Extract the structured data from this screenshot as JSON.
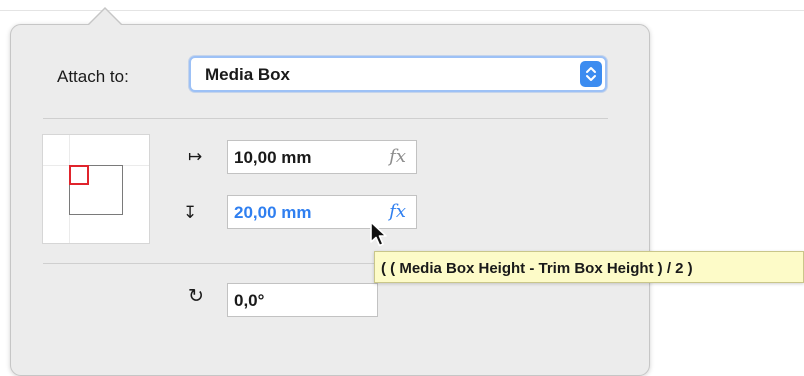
{
  "attach": {
    "label": "Attach to:",
    "selected": "Media Box"
  },
  "position": {
    "x_value": "10,00 mm",
    "y_value": "20,00 mm",
    "fx_label": "fx",
    "horizontal_icon": "↦",
    "vertical_icon": "↧"
  },
  "rotation": {
    "icon": "↻",
    "value": "0,0°"
  },
  "tooltip": {
    "text": "( ( Media Box Height - Trim Box Height ) / 2 )"
  },
  "colors": {
    "accent": "#3c8cf0",
    "active_text": "#2f7ff0",
    "anchor_marker": "#e0242c",
    "tooltip_bg": "#fdfbc8"
  },
  "icons": {
    "select": "up-down-chevron-icon",
    "cursor": "mouse-pointer-icon"
  }
}
